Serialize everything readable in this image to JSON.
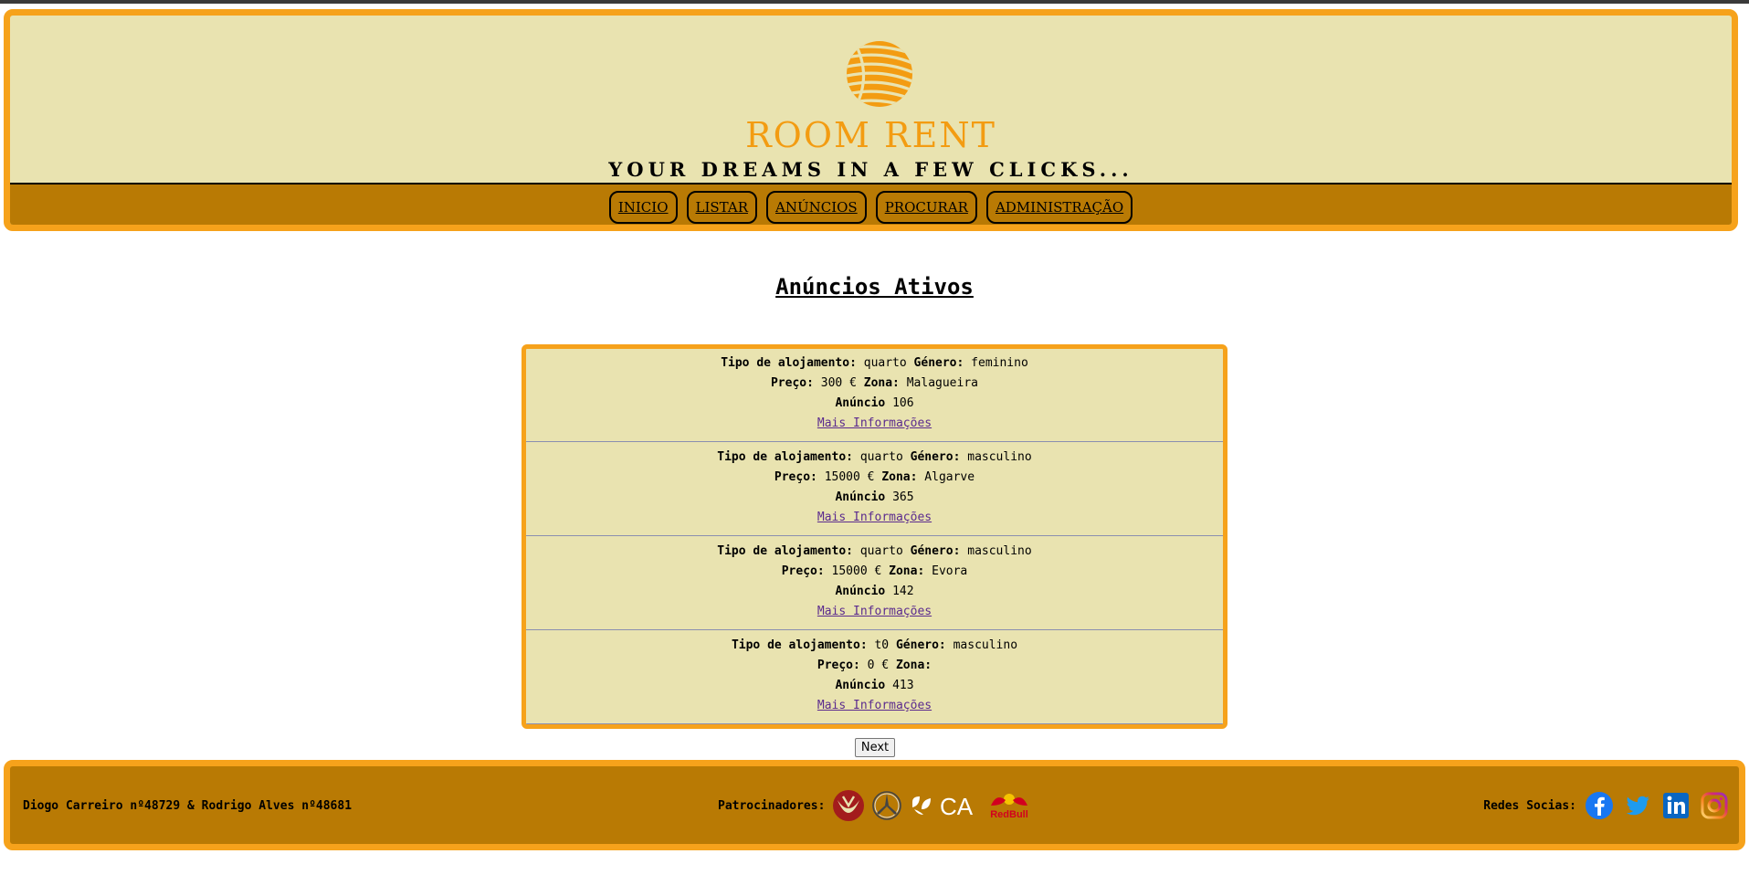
{
  "header": {
    "brand": "ROOM RENT",
    "tagline": "YOUR DREAMS IN A FEW CLICKS...",
    "logo_icon": "sun-stripes-logo"
  },
  "nav": {
    "items": [
      {
        "label": "INICIO"
      },
      {
        "label": "LISTAR"
      },
      {
        "label": "ANÚNCIOS"
      },
      {
        "label": "PROCURAR"
      },
      {
        "label": "ADMINISTRAÇÃO"
      }
    ]
  },
  "main": {
    "title": "Anúncios Ativos",
    "labels": {
      "tipo": "Tipo de alojamento:",
      "genero": "Género:",
      "preco": "Preço:",
      "zona": "Zona:",
      "anuncio": "Anúncio",
      "more": "Mais Informações"
    },
    "listings": [
      {
        "tipo": "quarto",
        "genero": "feminino",
        "preco": "300 €",
        "zona": "Malagueira",
        "anuncio": "106"
      },
      {
        "tipo": "quarto",
        "genero": "masculino",
        "preco": "15000 €",
        "zona": "Algarve",
        "anuncio": "365"
      },
      {
        "tipo": "quarto",
        "genero": "masculino",
        "preco": "15000 €",
        "zona": "Evora",
        "anuncio": "142"
      },
      {
        "tipo": "t0",
        "genero": "masculino",
        "preco": "0 €",
        "zona": "",
        "anuncio": "413"
      }
    ],
    "next_label": "Next"
  },
  "footer": {
    "authors": "Diogo Carreiro nº48729 & Rodrigo Alves nº48681",
    "sponsors_label": "Patrocinadores:",
    "sponsors": [
      "university-crest-logo",
      "mercedes-logo",
      "credito-agricola-logo",
      "redbull-logo"
    ],
    "ca_text": "CA",
    "redbull_text": "RedBull",
    "social_label": "Redes Socias:",
    "social": [
      "facebook-icon",
      "twitter-icon",
      "linkedin-icon",
      "instagram-icon"
    ]
  },
  "colors": {
    "accent": "#f6a21b",
    "header_bg": "#e9e3b0",
    "nav_bg": "#b97a04",
    "brand": "#f39c12"
  }
}
